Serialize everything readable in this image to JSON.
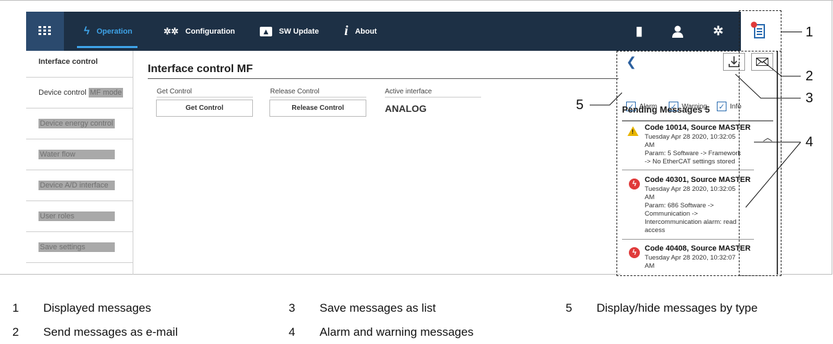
{
  "topbar": {
    "tabs": [
      {
        "label": "Operation"
      },
      {
        "label": "Configuration"
      },
      {
        "label": "SW Update"
      },
      {
        "label": "About"
      }
    ]
  },
  "sidebar": {
    "items": [
      {
        "label": "Interface control"
      },
      {
        "label": "Device control",
        "suffix": "MF mode"
      },
      {
        "label": "Device energy control"
      },
      {
        "label": "Water flow"
      },
      {
        "label": "Device A/D interface"
      },
      {
        "label": "User roles"
      },
      {
        "label": "Save settings"
      }
    ]
  },
  "main": {
    "title": "Interface control MF",
    "get_control_label": "Get Control",
    "get_control_button": "Get Control",
    "release_control_label": "Release Control",
    "release_control_button": "Release Control",
    "active_interface_label": "Active interface",
    "active_interface_value": "ANALOG"
  },
  "messages": {
    "filters": [
      {
        "label": "Alarm",
        "checked": true
      },
      {
        "label": "Warning",
        "checked": true
      },
      {
        "label": "Info",
        "checked": true
      }
    ],
    "pending_title": "Pending Messages 5",
    "items": [
      {
        "type": "warning",
        "title": "Code 10014, Source MASTER",
        "lines": [
          "Tuesday Apr 28 2020, 10:32:05",
          "AM",
          "Param: 5 Software -> Framework",
          "-> No EtherCAT settings stored"
        ]
      },
      {
        "type": "alarm",
        "title": "Code 40301, Source MASTER",
        "lines": [
          "Tuesday Apr 28 2020, 10:32:05",
          "AM",
          "Param: 686 Software ->",
          "Communication ->",
          "Intercommunication alarm: read",
          "access"
        ]
      },
      {
        "type": "alarm",
        "title": "Code 40408, Source MASTER",
        "lines": [
          "Tuesday Apr 28 2020, 10:32:07",
          "AM"
        ]
      }
    ]
  },
  "callouts": [
    "1",
    "2",
    "3",
    "4",
    "5"
  ],
  "legend": [
    {
      "n": "1",
      "text": "Displayed messages"
    },
    {
      "n": "2",
      "text": "Send messages as e-mail"
    },
    {
      "n": "3",
      "text": "Save messages as list"
    },
    {
      "n": "4",
      "text": "Alarm and warning messages"
    },
    {
      "n": "5",
      "text": "Display/hide messages by type"
    }
  ],
  "colors": {
    "topbar": "#1d3045",
    "accent": "#3ea3e8",
    "alarm": "#e03a3a",
    "warning": "#e8b500"
  },
  "icons": [
    "apps-grid-icon",
    "lightning-icon",
    "gears-icon",
    "upload-folder-icon",
    "info-icon",
    "door-exit-icon",
    "user-icon",
    "settings-gear-icon",
    "messages-list-icon",
    "chevron-left-icon",
    "download-icon",
    "email-icon",
    "warning-icon",
    "alarm-icon",
    "chevron-up-icon"
  ]
}
